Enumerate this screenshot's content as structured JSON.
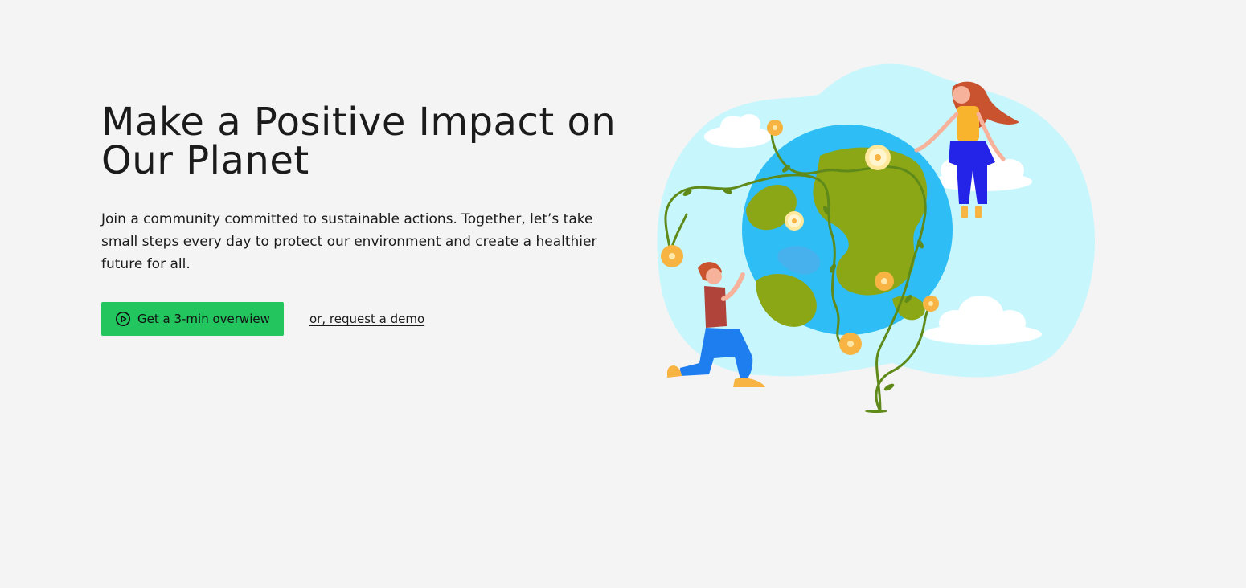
{
  "hero": {
    "title_line1": "Make a Positive Impact on",
    "title_line2": "Our Planet",
    "description": "Join a community committed to sustainable actions. Together, let’s take small steps every day to protect our environment and create a healthier future for all.",
    "primary_cta": {
      "label": "Get a 3-min overwiew",
      "icon": "play-circle-icon"
    },
    "secondary_link": "or, request a demo"
  },
  "illustration": {
    "subject": "earth-globe-with-vines-and-people-illustration"
  },
  "colors": {
    "background": "#f4f4f4",
    "accent_green": "#22c55e",
    "text": "#1b1b1b",
    "sky_blob": "#c7f6fd",
    "ocean": "#2ebdf5",
    "land": "#8ba716",
    "vine": "#5f8a1a",
    "flower_orange": "#f7b442",
    "woman_pants": "#2424e8",
    "man_pants": "#1e7ef0"
  }
}
